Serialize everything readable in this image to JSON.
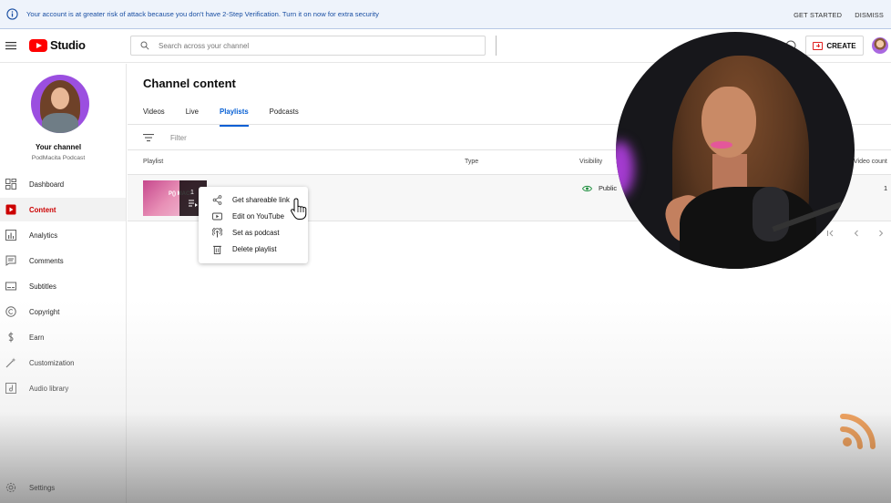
{
  "banner": {
    "message": "Your account is at greater risk of attack because you don't have 2-Step Verification. Turn it on now for extra security",
    "get_started": "GET STARTED",
    "dismiss": "DISMISS"
  },
  "header": {
    "logo_text": "Studio",
    "search_placeholder": "Search across your channel",
    "create_label": "CREATE"
  },
  "sidebar": {
    "your_channel": "Your channel",
    "channel_name": "PodMacita Podcast",
    "items": [
      {
        "label": "Dashboard",
        "icon": "dashboard-icon"
      },
      {
        "label": "Content",
        "icon": "content-icon",
        "active": true
      },
      {
        "label": "Analytics",
        "icon": "analytics-icon"
      },
      {
        "label": "Comments",
        "icon": "comments-icon"
      },
      {
        "label": "Subtitles",
        "icon": "subtitles-icon"
      },
      {
        "label": "Copyright",
        "icon": "copyright-icon"
      },
      {
        "label": "Earn",
        "icon": "earn-icon"
      },
      {
        "label": "Customization",
        "icon": "customization-icon"
      },
      {
        "label": "Audio library",
        "icon": "audio-library-icon"
      }
    ],
    "settings": "Settings"
  },
  "main": {
    "title": "Channel content",
    "tabs": [
      {
        "label": "Videos"
      },
      {
        "label": "Live"
      },
      {
        "label": "Playlists",
        "active": true
      },
      {
        "label": "Podcasts"
      }
    ],
    "filter_label": "Filter",
    "columns": {
      "playlist": "Playlist",
      "type": "Type",
      "visibility": "Visibility",
      "video_count": "Video count"
    },
    "rows": [
      {
        "thumb_text": "P() MACI",
        "count_badge": "1",
        "visibility": "Public",
        "video_count": "1"
      }
    ]
  },
  "menu": {
    "items": [
      {
        "label": "Get shareable link",
        "icon": "share-icon"
      },
      {
        "label": "Edit on YouTube",
        "icon": "youtube-icon"
      },
      {
        "label": "Set as podcast",
        "icon": "podcast-icon"
      },
      {
        "label": "Delete playlist",
        "icon": "trash-icon"
      }
    ]
  },
  "colors": {
    "accent": "#065fd4",
    "brand_red": "#ff0000",
    "banner_bg": "#eef3fb",
    "rss_orange": "#f5821f"
  }
}
